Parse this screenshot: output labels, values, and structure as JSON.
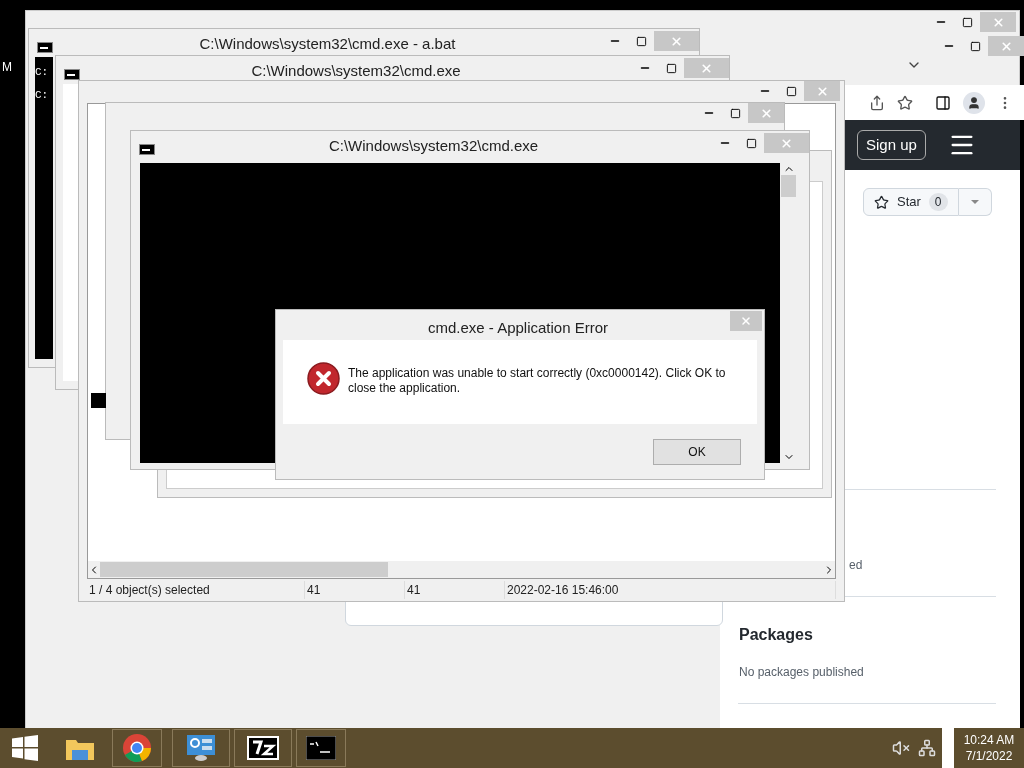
{
  "desktop": {
    "edge_text": "M"
  },
  "batch_window": {
    "title": "C:\\Windows\\system32\\cmd.exe - a.bat",
    "console_lines": [
      "C:",
      "C:"
    ]
  },
  "cmd_window": {
    "title": "C:\\Windows\\system32\\cmd.exe"
  },
  "front_cmd_window": {
    "title": "C:\\Windows\\system32\\cmd.exe"
  },
  "browser": {
    "header_button": "Sign up",
    "star_button": {
      "label": "Star",
      "count": "0"
    },
    "partial_text": "ed",
    "packages": {
      "heading": "Packages",
      "note": "No packages published"
    }
  },
  "explorer": {
    "status_bar": [
      "1 / 4 object(s) selected",
      "41",
      "41",
      "2022-02-16 15:46:00"
    ]
  },
  "error_dialog": {
    "title": "cmd.exe - Application Error",
    "message": "The application was unable to start correctly (0xc0000142). Click OK to close the application.",
    "buttons": [
      "OK"
    ]
  },
  "taskbar": {
    "time": "10:24 AM",
    "date": "7/1/2022"
  }
}
